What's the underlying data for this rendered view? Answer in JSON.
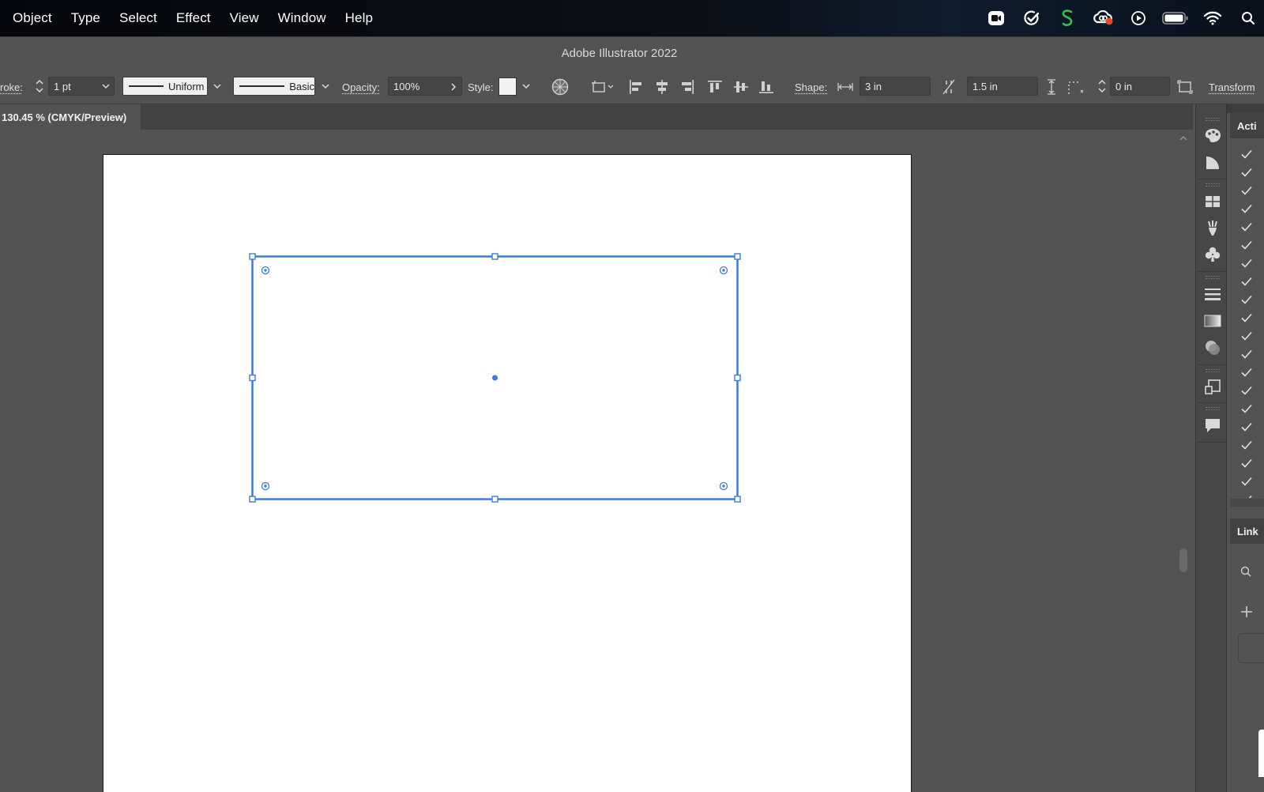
{
  "menubar": {
    "items": [
      "Object",
      "Type",
      "Select",
      "Effect",
      "View",
      "Window",
      "Help"
    ],
    "status_icons": [
      "zoom-icon",
      "checkmark-app-icon",
      "scrivener-icon",
      "creative-cloud-icon",
      "play-icon",
      "battery-icon",
      "wifi-icon",
      "spotlight-search-icon"
    ]
  },
  "titlebar": {
    "title": "Adobe Illustrator 2022"
  },
  "controlbar": {
    "stroke_label": "roke:",
    "stroke_weight": "1 pt",
    "profile_label": "Uniform",
    "brush_label": "Basic",
    "opacity_label": "Opacity:",
    "opacity_value": "100%",
    "style_label": "Style:",
    "shape_label": "Shape:",
    "width_value": "3 in",
    "height_value": "1.5 in",
    "corner_value": "0 in",
    "transform_label": "Transform"
  },
  "document": {
    "tab_label": "130.45 % (CMYK/Preview)"
  },
  "panels": {
    "actions_label": "Acti",
    "links_label": "Link",
    "action_checks": 19
  },
  "colors": {
    "selection": "#3d7ae0",
    "ui_background": "#535353",
    "accent_red": "#e5492d",
    "accent_green": "#35c24a"
  }
}
